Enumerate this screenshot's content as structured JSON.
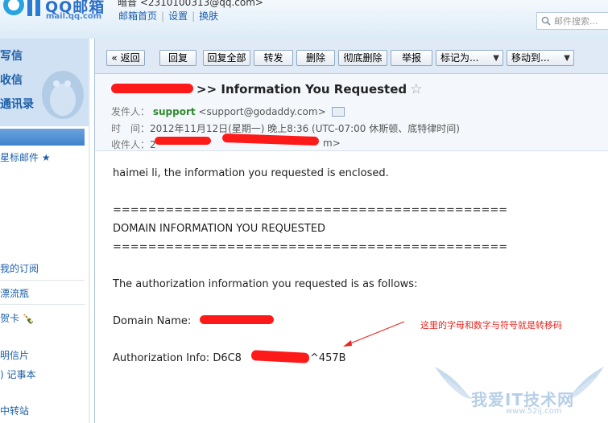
{
  "header": {
    "brand": "QQ邮箱",
    "brand_sub": "mail.qq.com",
    "account": "暗音 <2310100313@qq.com> ˅",
    "nav": [
      "邮箱首页",
      "设置",
      "换肤"
    ],
    "search_placeholder": "邮件搜索..."
  },
  "sidebar": {
    "big_items": [
      "写信",
      "收信",
      "通讯录"
    ],
    "items": [
      {
        "label": "星标邮件 ★"
      },
      {
        "label": "我的订阅"
      },
      {
        "label": "漂流瓶"
      },
      {
        "label": "贺卡 🍾"
      },
      {
        "label": "明信片"
      },
      {
        "label": ") 记事本"
      },
      {
        "label": "中转站"
      }
    ]
  },
  "toolbar": {
    "buttons": [
      "« 返回",
      "回复",
      "回复全部",
      "转发",
      "删除",
      "彻底删除",
      "举报"
    ],
    "mark_as": "标记为...",
    "move_to": "移动到..."
  },
  "email": {
    "subject": ">> Information You Requested",
    "from_label": "发件人：",
    "from_name": "support",
    "from_addr": "<support@godaddy.com>",
    "time_label": "时　间：",
    "time_value": "2012年11月12日(星期一) 晚上8:36 (UTC-07:00 休斯顿、底特律时间)",
    "to_label": "收件人：",
    "to_value": "2",
    "to_tail": "m>",
    "body": {
      "greeting": "haimei li, the information you requested is enclosed.",
      "rule": "=============================================",
      "heading": "DOMAIN INFORMATION YOU REQUESTED",
      "intro": "The authorization information you requested is as follows:",
      "domain_label": "Domain Name:",
      "auth_label": "Authorization Info: D6C8",
      "auth_tail": "^457B"
    }
  },
  "annotation": {
    "note": "这里的字母和数字与符号就是转移码",
    "color": "#e8261f"
  },
  "watermark": {
    "text": "我爱IT技术网",
    "url": "www.52ij.com"
  },
  "colors": {
    "link": "#1d5fa8",
    "sender_name": "#2d8a2d",
    "redaction": "#ff1a1a"
  }
}
